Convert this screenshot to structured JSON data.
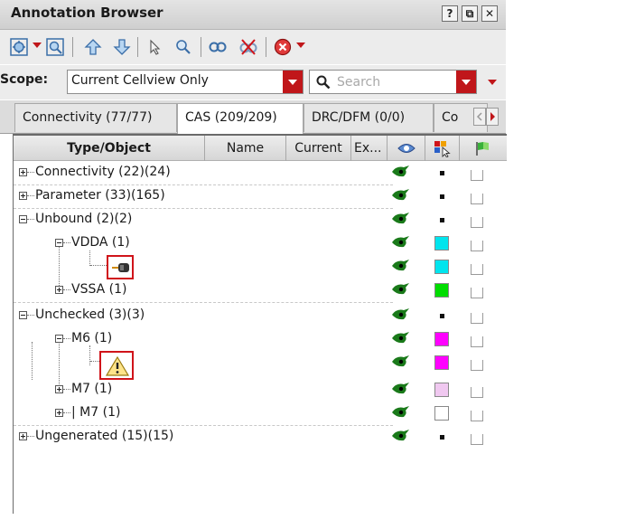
{
  "window": {
    "title": "Annotation Browser",
    "buttons": [
      "?",
      "⧉",
      "✕"
    ]
  },
  "scope": {
    "label": "Scope:",
    "value": "Current Cellview Only",
    "search_placeholder": "Search"
  },
  "tabs": [
    {
      "label": "Connectivity (77/77)",
      "active": false
    },
    {
      "label": "CAS (209/209)",
      "active": true
    },
    {
      "label": "DRC/DFM (0/0)",
      "active": false
    },
    {
      "label": "Co",
      "active": false
    }
  ],
  "columns": {
    "type": "Type/Object",
    "name": "Name",
    "current": "Current",
    "extra": "Ex..."
  },
  "rows": [
    {
      "label": "Connectivity (22)(24)",
      "expander": "plus",
      "marker": "dot",
      "color": ""
    },
    {
      "label": "Parameter (33)(165)",
      "expander": "plus",
      "marker": "dot",
      "color": ""
    },
    {
      "label": "Unbound (2)(2)",
      "expander": "minus",
      "marker": "dot",
      "color": ""
    },
    {
      "label": "VDDA (1)",
      "expander": "minus",
      "marker": "swatch",
      "color": "#00e5ee"
    },
    {
      "label": "",
      "icon": "probe-icon",
      "marker": "swatch",
      "color": "#00e5ee"
    },
    {
      "label": "VSSA (1)",
      "expander": "plus",
      "marker": "swatch",
      "color": "#00dd00"
    },
    {
      "label": "Unchecked (3)(3)",
      "expander": "minus",
      "marker": "dot",
      "color": ""
    },
    {
      "label": "M6 (1)",
      "expander": "minus",
      "marker": "swatch",
      "color": "#ff00ff"
    },
    {
      "label": "",
      "icon": "warning-icon",
      "marker": "swatch",
      "color": "#ff00ff"
    },
    {
      "label": "M7 (1)",
      "expander": "plus",
      "marker": "swatch",
      "color": "#f0c8f0"
    },
    {
      "label": "| M7 (1)",
      "expander": "plus",
      "marker": "swatch",
      "color": "#ffffff"
    },
    {
      "label": "Ungenerated (15)(15)",
      "expander": "plus",
      "marker": "dot",
      "color": ""
    }
  ],
  "colors": {
    "accent_red": "#c0161a",
    "eye_green": "#1a7a1a"
  }
}
